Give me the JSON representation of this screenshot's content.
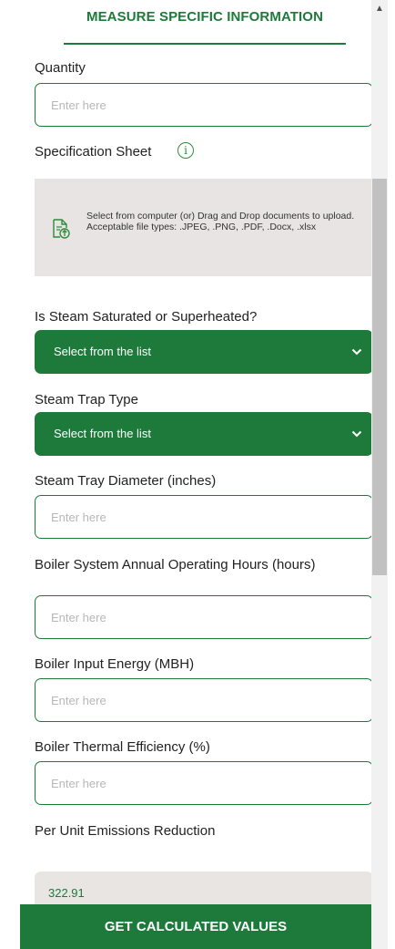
{
  "header": {
    "title": "MEASURE SPECIFIC INFORMATION"
  },
  "form": {
    "quantity": {
      "label": "Quantity",
      "placeholder": "Enter here"
    },
    "spec_sheet": {
      "label": "Specification Sheet",
      "info_icon": "info-icon",
      "upload_text": "Select from computer (or) Drag and Drop documents to upload. Acceptable file types: .JPEG, .PNG, .PDF, .Docx, .xlsx"
    },
    "steam_state": {
      "label": "Is Steam Saturated or Superheated?",
      "selected": "Select from the list"
    },
    "trap_type": {
      "label": "Steam Trap Type",
      "selected": "Select from the list"
    },
    "tray_diameter": {
      "label": "Steam Tray Diameter (inches)",
      "placeholder": "Enter here"
    },
    "operating_hours": {
      "label": "Boiler System Annual Operating Hours (hours)",
      "placeholder": "Enter here"
    },
    "input_energy": {
      "label": "Boiler Input Energy (MBH)",
      "placeholder": "Enter here"
    },
    "thermal_efficiency": {
      "label": "Boiler Thermal Efficiency (%)",
      "placeholder": "Enter here"
    },
    "emissions_reduction": {
      "label": "Per Unit Emissions Reduction",
      "value": "322.91"
    }
  },
  "actions": {
    "calculate_label": "GET CALCULATED VALUES"
  },
  "colors": {
    "accent": "#1e7a3b",
    "upload_bg": "#e8e4e3",
    "readonly_bg": "#e8e5e2"
  }
}
